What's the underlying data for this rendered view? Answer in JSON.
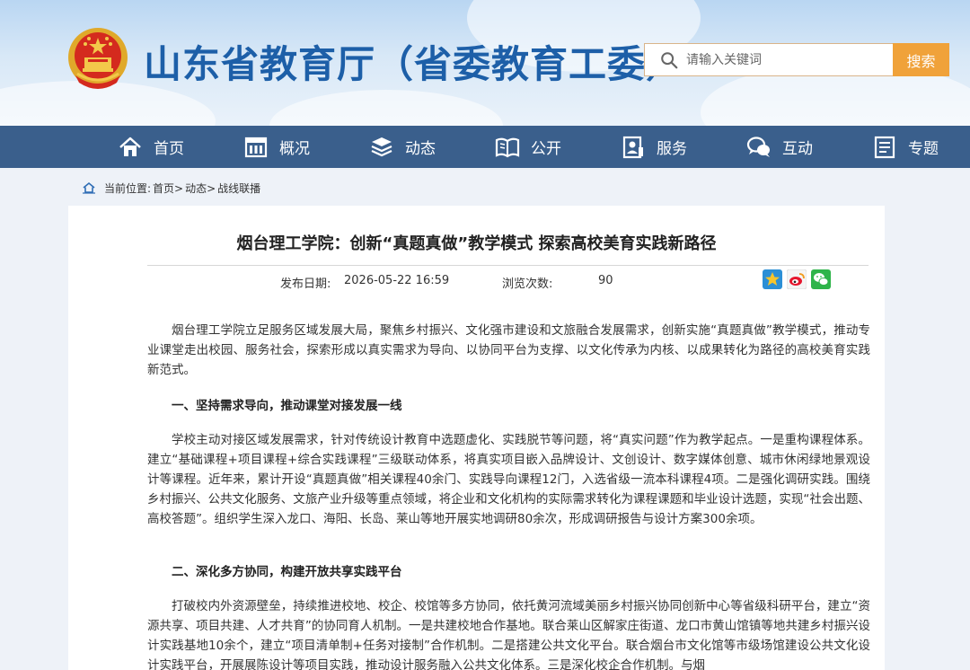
{
  "header": {
    "site_title": "山东省教育厅（省委教育工委）",
    "search_placeholder": "请输入关键词",
    "search_button": "搜索"
  },
  "nav": {
    "items": [
      {
        "label": "首页",
        "icon": "home-icon"
      },
      {
        "label": "概况",
        "icon": "building-icon"
      },
      {
        "label": "动态",
        "icon": "book-stack-icon"
      },
      {
        "label": "公开",
        "icon": "open-book-icon"
      },
      {
        "label": "服务",
        "icon": "service-icon"
      },
      {
        "label": "互动",
        "icon": "chat-icon"
      },
      {
        "label": "专题",
        "icon": "document-icon"
      }
    ]
  },
  "breadcrumb": {
    "prefix": "当前位置:",
    "items": [
      "首页>",
      "动态>",
      "战线联播"
    ]
  },
  "article": {
    "title": "烟台理工学院：创新“真题真做”教学模式 探索高校美育实践新路径",
    "date_label": "发布日期:",
    "date_value": "2026-05-22 16:59",
    "views_label": "浏览次数:",
    "views_value": "90",
    "share_icons": [
      "qzone-share-icon",
      "weibo-share-icon",
      "wechat-share-icon"
    ],
    "paragraphs": [
      "烟台理工学院立足服务区域发展大局，聚焦乡村振兴、文化强市建设和文旅融合发展需求，创新实施“真题真做”教学模式，推动专业课堂走出校园、服务社会，探索形成以真实需求为导向、以协同平台为支撑、以文化传承为内核、以成果转化为路径的高校美育实践新范式。",
      "学校主动对接区域发展需求，针对传统设计教育中选题虚化、实践脱节等问题，将“真实问题”作为教学起点。一是重构课程体系。建立“基础课程+项目课程+综合实践课程”三级联动体系，将真实项目嵌入品牌设计、文创设计、数字媒体创意、城市休闲绿地景观设计等课程。近年来，累计开设“真题真做”相关课程40余门、实践导向课程12门，入选省级一流本科课程4项。二是强化调研实践。围绕乡村振兴、公共文化服务、文旅产业升级等重点领域，将企业和文化机构的实际需求转化为课程课题和毕业设计选题，实现“社会出题、高校答题”。组织学生深入龙口、海阳、长岛、莱山等地开展实地调研80余次，形成调研报告与设计方案300余项。",
      "打破校内外资源壁垒，持续推进校地、校企、校馆等多方协同，依托黄河流域美丽乡村振兴协同创新中心等省级科研平台，建立“资源共享、项目共建、人才共育”的协同育人机制。一是共建校地合作基地。联合莱山区解家庄街道、龙口市黄山馆镇等地共建乡村振兴设计实践基地10余个，建立“项目清单制+任务对接制”合作机制。二是搭建公共文化平台。联合烟台市文化馆等市级场馆建设公共文化设计实践平台，开展展陈设计等项目实践，推动设计服务融入公共文化体系。三是深化校企合作机制。与烟"
    ],
    "headings": [
      "一、坚持需求导向，推动课堂对接发展一线",
      "二、深化多方协同，构建开放共享实践平台"
    ]
  },
  "colors": {
    "brand_blue": "#1d5fa8",
    "nav_bg": "#3a5f8c",
    "search_button": "#f0a23a"
  }
}
